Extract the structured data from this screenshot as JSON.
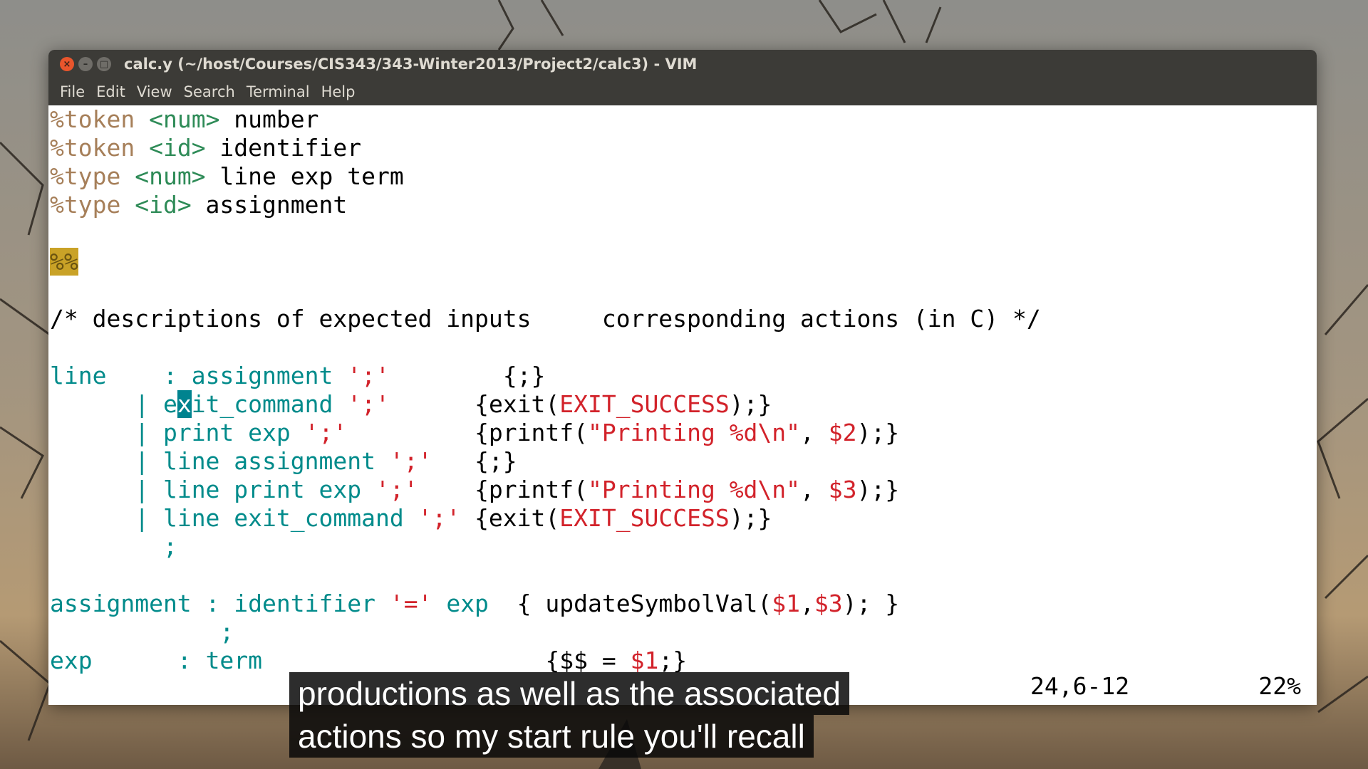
{
  "window": {
    "title": "calc.y (~/host/Courses/CIS343/343-Winter2013/Project2/calc3) - VIM",
    "controls": {
      "close": "×",
      "minimize": "–",
      "maximize": "□"
    }
  },
  "menu": [
    "File",
    "Edit",
    "View",
    "Search",
    "Terminal",
    "Help"
  ],
  "code": {
    "l1": [
      "%token",
      " <num>",
      " number"
    ],
    "l2": [
      "%token",
      " <id>",
      " identifier"
    ],
    "l3": [
      "%type",
      " <num>",
      " line exp term"
    ],
    "l4": [
      "%type",
      " <id>",
      " assignment"
    ],
    "sep": "%%",
    "comment": "/* descriptions of expected inputs     corresponding actions (in C) */",
    "r1": {
      "name": "line",
      "colon": "    : ",
      "body": "assignment ",
      "str": "';'",
      "pad": "        ",
      "act": "{;}"
    },
    "r2": {
      "bar": "      | ",
      "pre": "e",
      "cur": "x",
      "post": "it_command ",
      "str": "';'",
      "pad": "      ",
      "a1": "{exit(",
      "a2": "EXIT_SUCCESS",
      "a3": ");}"
    },
    "r3": {
      "bar": "      | ",
      "body": "print exp ",
      "str": "';'",
      "pad": "         ",
      "a1": "{printf(",
      "a2": "\"Printing %d\\n\"",
      "a3": ", ",
      "a4": "$2",
      "a5": ");}"
    },
    "r4": {
      "bar": "      | ",
      "body": "line assignment ",
      "str": "';'",
      "pad": "   ",
      "act": "{;}"
    },
    "r5": {
      "bar": "      | ",
      "body": "line print exp ",
      "str": "';'",
      "pad": "    ",
      "a1": "{printf(",
      "a2": "\"Printing %d\\n\"",
      "a3": ", ",
      "a4": "$3",
      "a5": ");}"
    },
    "r6": {
      "bar": "      | ",
      "body": "line exit_command ",
      "str": "';'",
      "pad": " ",
      "a1": "{exit(",
      "a2": "EXIT_SUCCESS",
      "a3": ");}"
    },
    "r7": "        ;",
    "asg": {
      "name": "assignment",
      "colon": " : ",
      "body": "identifier ",
      "str": "'='",
      "body2": " exp  ",
      "a1": "{ updateSymbolVal(",
      "a2": "$1",
      "a3": ",",
      "a4": "$3",
      "a5": "); }"
    },
    "asg_end": "            ;",
    "exp": {
      "name": "exp",
      "colon": "      : ",
      "body": "term",
      "pad": "                    ",
      "a1": "{$$ = ",
      "a2": "$1",
      "a3": ";}"
    }
  },
  "status": {
    "position": "24,6-12",
    "percent": "22%"
  },
  "caption": {
    "line1": "productions as well as the associated",
    "line2": "actions so my start rule you'll recall"
  }
}
